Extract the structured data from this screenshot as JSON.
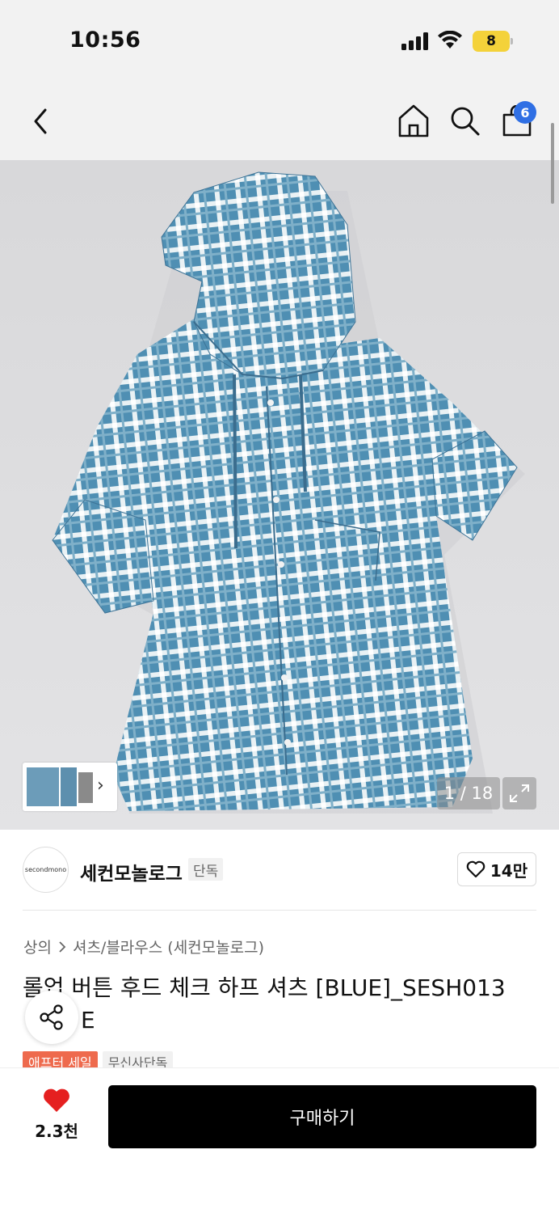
{
  "status_bar": {
    "time": "10:56",
    "battery": "8"
  },
  "nav": {
    "cart_count": "6",
    "icons": [
      "chevron-left-icon",
      "home-icon",
      "search-icon",
      "shopping-bag-icon"
    ]
  },
  "gallery": {
    "counter": "1 / 18",
    "thumbnail_chevron": "›",
    "image": "blue-check-hooded-shirt"
  },
  "brand": {
    "logo_text": "secondmono",
    "name": "세컨모놀로그",
    "tag": "단독",
    "likes": "14만"
  },
  "product": {
    "crumb_parent": "상의",
    "crumb_child": "셔츠/블라우스 (세컨모놀로그)",
    "title": "롤업 버튼 후드 체크 하프 셔츠 [BLUE]_SESH013",
    "title_line2": "E",
    "tags": [
      "애프터 세일",
      "무신사단독"
    ]
  },
  "bottom_bar": {
    "wish_count": "2.3천",
    "buy_label": "구매하기"
  },
  "colors": {
    "accent_blue": "#2f6fe4",
    "sale_tag": "#ee6a4d",
    "heart": "#e52020",
    "buy_button": "#000000"
  }
}
